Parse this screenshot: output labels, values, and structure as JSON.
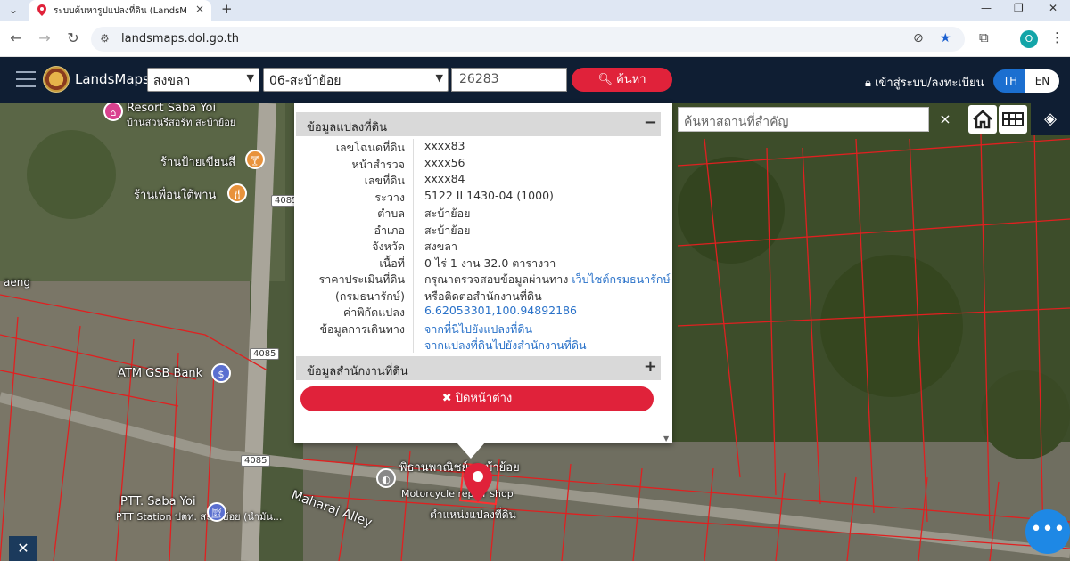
{
  "browser": {
    "tab_title": "ระบบค้นหารูปแปลงที่ดิน (LandsMaps)",
    "tab_close": "×",
    "new_tab": "+",
    "url": "landsmaps.dol.go.th",
    "profile_initial": "O"
  },
  "header": {
    "brand": "LandsMaps",
    "province_value": "สงขลา",
    "district_value": "06-สะบ้าย้อย",
    "parcel_number": "26283",
    "search_label": "ค้นหา",
    "login_label": "เข้าสู่ระบบ/ลงทะเบียน",
    "lang_th": "TH",
    "lang_en": "EN",
    "accent_color": "#e0223a",
    "header_bg": "#0f1e33"
  },
  "map": {
    "place_search_placeholder": "ค้นหาสถานที่สำคัญ",
    "clear_label": "×",
    "labels": {
      "resort": "Resort Saba Yoi",
      "resort_thai": "บ้านสวนรีสอร์ท สะบ้าย้อย",
      "ran_pai": "ร้านป้ายเขียนสี",
      "ran_pueon": "ร้านเพื่อนใต้พาน",
      "atm": "ATM GSB Bank",
      "ptt": "PTT. Saba Yoi",
      "ptt_thai": "PTT Station ปตท. สะบ้าย้อย (นำมัน...",
      "phithan": "พิธานพาณิชย์ สะบ้าย้อย",
      "motorcycle": "Motorcycle repair shop",
      "maharaj": "Maharaj Alley",
      "parcel_position": "ตำแหน่งแปลงที่ดิน",
      "aeng": "aeng",
      "road_4085": "4085"
    }
  },
  "popup": {
    "section1_title": "ข้อมูลแปลงที่ดิน",
    "section1_sign": "−",
    "rows": [
      {
        "key": "เลขโฉนดที่ดิน",
        "value": "xxxx83"
      },
      {
        "key": "หน้าสำรวจ",
        "value": "xxxx56"
      },
      {
        "key": "เลขที่ดิน",
        "value": "xxxx84"
      },
      {
        "key": "ระวาง",
        "value": "5122 II 1430-04 (1000)"
      },
      {
        "key": "ตำบล",
        "value": "สะบ้าย้อย"
      },
      {
        "key": "อำเภอ",
        "value": "สะบ้าย้อย"
      },
      {
        "key": "จังหวัด",
        "value": "สงขลา"
      },
      {
        "key": "เนื้อที่",
        "value": "0 ไร่ 1 งาน 32.0 ตารางวา"
      }
    ],
    "price_key_1": "ราคาประเมินที่ดิน",
    "price_key_2": "(กรมธนารักษ์)",
    "price_value_prefix": "กรุณาตรวจสอบข้อมูลผ่านทาง",
    "price_value_link": "เว็บไซต์กรมธนารักษ์",
    "price_value_2": "หรือติดต่อสำนักงานที่ดิน",
    "coord_key": "ค่าพิกัดแปลง",
    "coord_value": "6.62053301,100.94892186",
    "route_key": "ข้อมูลการเดินทาง",
    "route_link_1": "จากที่นี่ไปยังแปลงที่ดิน",
    "route_link_2": "จากแปลงที่ดินไปยังสำนักงานที่ดิน",
    "section2_title": "ข้อมูลสำนักงานที่ดิน",
    "section2_sign": "+",
    "close_label": "✖ ปิดหน้าต่าง"
  }
}
